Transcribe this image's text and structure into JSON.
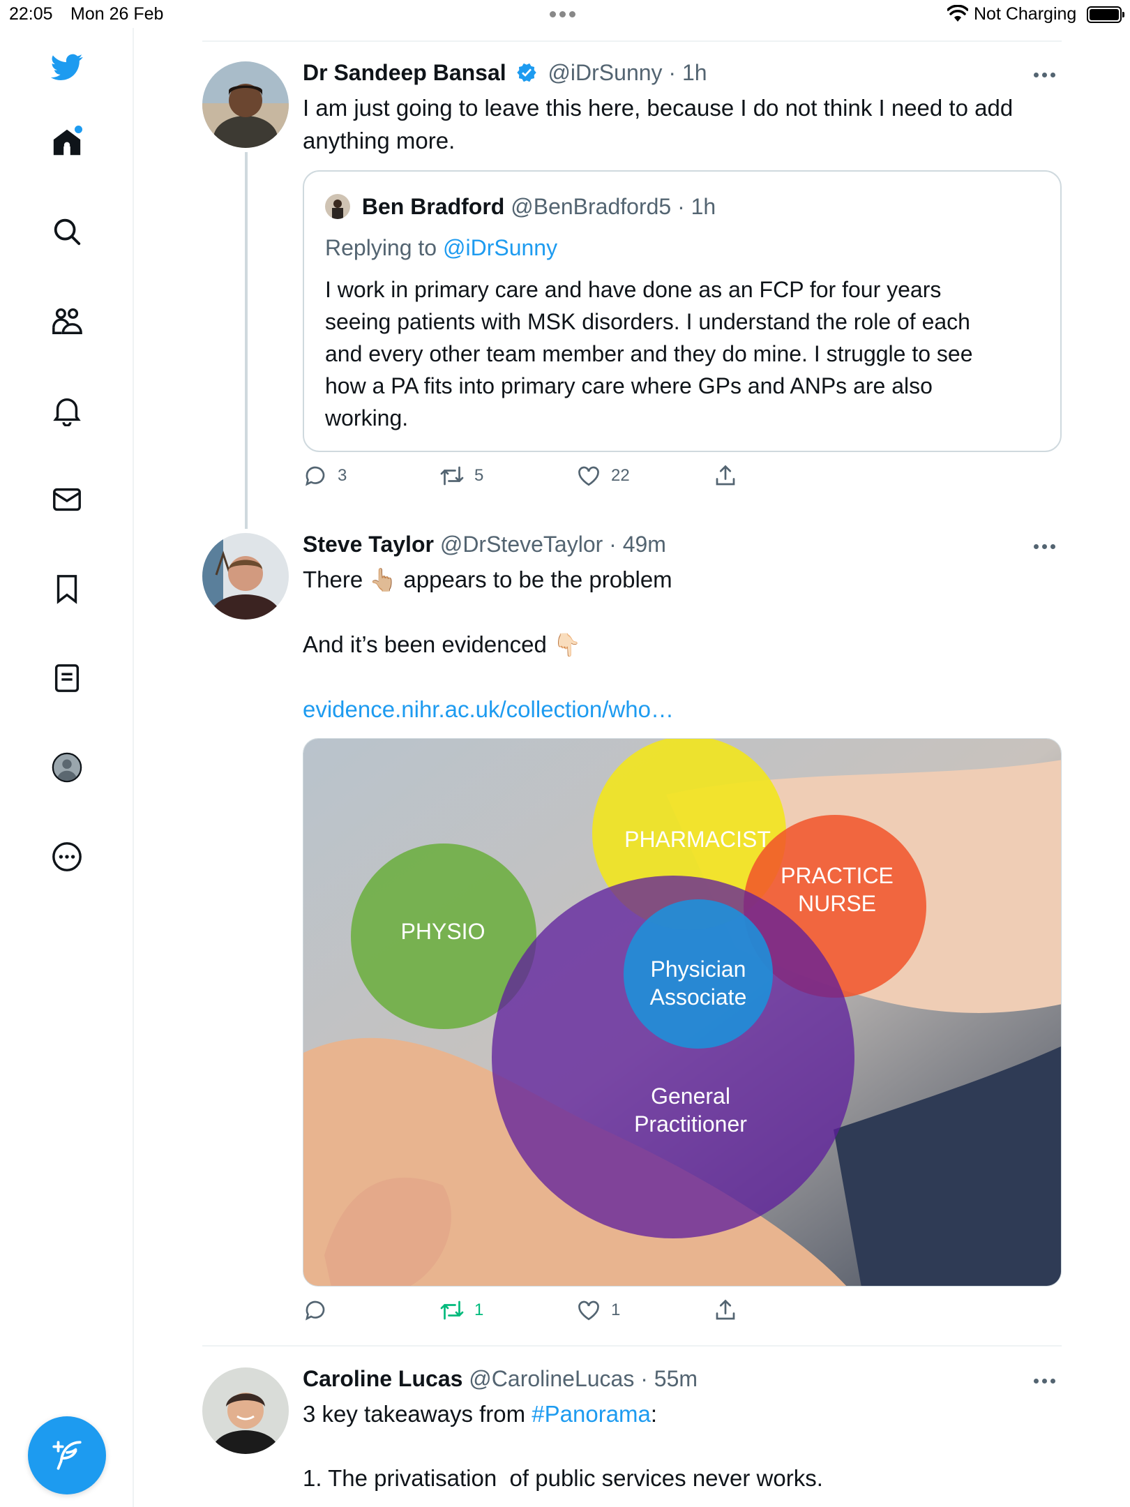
{
  "status_bar": {
    "time": "22:05",
    "date": "Mon 26 Feb",
    "charging": "Not Charging"
  },
  "sidebar": {
    "items": [
      {
        "icon": "home-icon"
      },
      {
        "icon": "search-icon"
      },
      {
        "icon": "communities-icon"
      },
      {
        "icon": "notifications-icon"
      },
      {
        "icon": "messages-icon"
      },
      {
        "icon": "bookmarks-icon"
      },
      {
        "icon": "lists-icon"
      },
      {
        "icon": "profile-icon"
      },
      {
        "icon": "more-icon"
      }
    ],
    "compose_icon": "compose-tweet-icon"
  },
  "colors": {
    "accent": "#1d9bf0",
    "retweet_green": "#00ba7c",
    "secondary_text": "#536471"
  },
  "tweets": [
    {
      "name": "Dr Sandeep Bansal",
      "verified": true,
      "handle": "@iDrSunny",
      "time": "· 1h",
      "text_line1": "I am just going to leave this here, because I do not think I need to add",
      "text_line2": "anything more.",
      "quote": {
        "name": "Ben Bradford",
        "handle": "@BenBradford5",
        "time": "· 1h",
        "replying_prefix": "Replying to",
        "replying_handle": "@iDrSunny",
        "lines": [
          "I work in primary care and have done as an FCP for four years",
          "seeing patients with MSK disorders. I understand the role of each",
          "and every other team member and they do mine. I struggle to see",
          "how a PA fits into primary care where GPs and ANPs are also",
          "working."
        ]
      },
      "replies": "3",
      "retweets": "5",
      "likes": "22"
    },
    {
      "name": "Steve Taylor",
      "handle": "@DrSteveTaylor",
      "time": "· 49m",
      "line1_a": "There",
      "line1_emoji": "👆🏼",
      "line1_b": "appears to be the problem",
      "line2_a": "And it’s been evidenced",
      "line2_emoji": "👇🏻",
      "link": "evidence.nihr.ac.uk/collection/who…",
      "image_labels": {
        "pharmacist": "PHARMACIST",
        "practice_nurse_1": "PRACTICE",
        "practice_nurse_2": "NURSE",
        "physio": "PHYSIO",
        "pa_1": "Physician",
        "pa_2": "Associate",
        "gp_1": "General",
        "gp_2": "Practitioner"
      },
      "replies": "",
      "retweets": "1",
      "likes": "1"
    },
    {
      "name": "Caroline Lucas",
      "handle": "@CarolineLucas",
      "time": "· 55m",
      "line1_a": "3 key takeaways from",
      "hashtag": "#Panorama",
      "line1_b": ":",
      "line2": "1. The privatisation  of public services never works."
    }
  ]
}
